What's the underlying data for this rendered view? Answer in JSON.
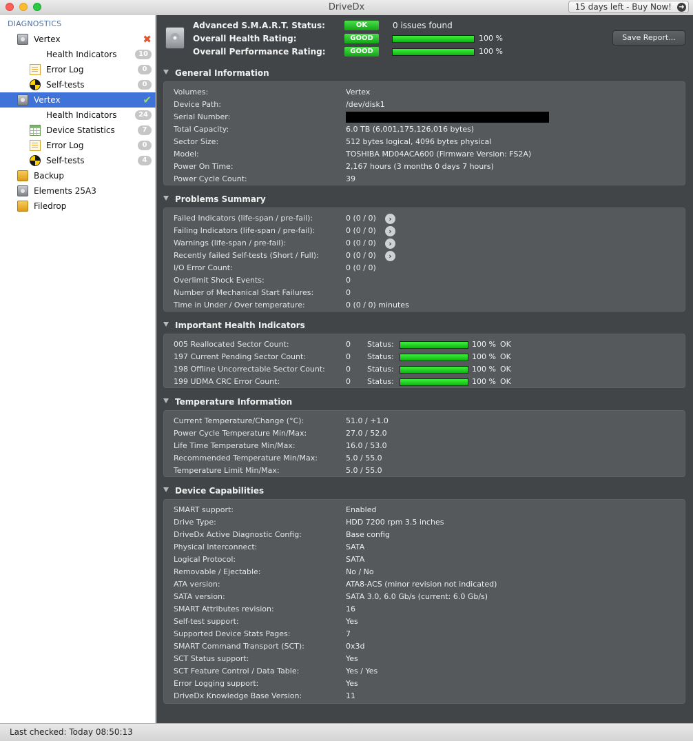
{
  "window": {
    "title": "DriveDx",
    "buy_label": "15 days left - Buy Now!"
  },
  "sidebar": {
    "header": "DIAGNOSTICS",
    "items": [
      {
        "label": "Vertex",
        "icon": "disk-icon",
        "mark": "✖"
      },
      {
        "label": "Health Indicators",
        "icon": "bars-icon",
        "badge": "10"
      },
      {
        "label": "Error Log",
        "icon": "log-icon",
        "badge": "0"
      },
      {
        "label": "Self-tests",
        "icon": "selftest-icon",
        "badge": "0"
      },
      {
        "label": "Vertex",
        "icon": "disk-icon",
        "mark": "✔",
        "selected": true
      },
      {
        "label": "Health Indicators",
        "icon": "bars-icon",
        "badge": "24"
      },
      {
        "label": "Device Statistics",
        "icon": "table-icon",
        "badge": "7"
      },
      {
        "label": "Error Log",
        "icon": "log-icon",
        "badge": "0"
      },
      {
        "label": "Self-tests",
        "icon": "selftest-icon",
        "badge": "4"
      },
      {
        "label": "Backup",
        "icon": "external-disk-icon"
      },
      {
        "label": "Elements 25A3",
        "icon": "disk-icon"
      },
      {
        "label": "Filedrop",
        "icon": "external-disk-icon"
      }
    ]
  },
  "summary": {
    "smart_label": "Advanced S.M.A.R.T. Status:",
    "smart_badge": "OK",
    "smart_text": "0 issues found",
    "health_label": "Overall Health Rating:",
    "health_badge": "GOOD",
    "health_value": 1.0,
    "health_pct": "100 %",
    "perf_label": "Overall Performance Rating:",
    "perf_badge": "GOOD",
    "perf_value": 1.0,
    "perf_pct": "100 %",
    "save_label": "Save Report..."
  },
  "general": {
    "title": "General Information",
    "rows": [
      {
        "label": "Volumes:",
        "value": "Vertex"
      },
      {
        "label": "Device Path:",
        "value": "/dev/disk1"
      },
      {
        "label": "Serial Number:",
        "value": ""
      },
      {
        "label": "Total Capacity:",
        "value": "6.0 TB (6,001,175,126,016 bytes)"
      },
      {
        "label": "Sector Size:",
        "value": "512 bytes logical, 4096 bytes physical"
      },
      {
        "label": "Model:",
        "value": "TOSHIBA MD04ACA600  (Firmware Version: FS2A)"
      },
      {
        "label": "Power On Time:",
        "value": "2,167 hours (3 months 0 days 7 hours)"
      },
      {
        "label": "Power Cycle Count:",
        "value": "39"
      }
    ]
  },
  "problems": {
    "title": "Problems Summary",
    "rows": [
      {
        "label": "Failed Indicators (life-span / pre-fail):",
        "value": "0 (0 / 0)",
        "arrow": true
      },
      {
        "label": "Failing Indicators (life-span / pre-fail):",
        "value": "0 (0 / 0)",
        "arrow": true
      },
      {
        "label": "Warnings (life-span / pre-fail):",
        "value": "0 (0 / 0)",
        "arrow": true
      },
      {
        "label": "Recently failed Self-tests (Short / Full):",
        "value": "0 (0 / 0)",
        "arrow": true
      },
      {
        "label": "I/O Error Count:",
        "value": "0 (0 / 0)"
      },
      {
        "label": "Overlimit Shock Events:",
        "value": "0"
      },
      {
        "label": "Number of Mechanical Start Failures:",
        "value": "0"
      },
      {
        "label": "Time in Under / Over temperature:",
        "value": "0 (0 / 0)  minutes"
      }
    ]
  },
  "health": {
    "title": "Important Health Indicators",
    "status_label": "Status:",
    "rows": [
      {
        "label": "005  Reallocated Sector Count:",
        "value": "0",
        "level": 1.0,
        "pct": "100 %",
        "status": "OK"
      },
      {
        "label": "197  Current Pending Sector Count:",
        "value": "0",
        "level": 1.0,
        "pct": "100 %",
        "status": "OK"
      },
      {
        "label": "198  Offline Uncorrectable Sector Count:",
        "value": "0",
        "level": 1.0,
        "pct": "100 %",
        "status": "OK"
      },
      {
        "label": "199  UDMA CRC Error Count:",
        "value": "0",
        "level": 1.0,
        "pct": "100 %",
        "status": "OK"
      }
    ]
  },
  "temperature": {
    "title": "Temperature Information",
    "rows": [
      {
        "label": "Current Temperature/Change (°C):",
        "value": "51.0 / +1.0"
      },
      {
        "label": "Power Cycle Temperature Min/Max:",
        "value": "27.0 / 52.0"
      },
      {
        "label": "Life Time Temperature Min/Max:",
        "value": "16.0 / 53.0"
      },
      {
        "label": "Recommended Temperature Min/Max:",
        "value": "5.0  / 55.0"
      },
      {
        "label": "Temperature Limit Min/Max:",
        "value": "5.0  / 55.0"
      }
    ]
  },
  "capabilities": {
    "title": "Device Capabilities",
    "rows": [
      {
        "label": "SMART support:",
        "value": "Enabled"
      },
      {
        "label": "Drive Type:",
        "value": "HDD 7200 rpm 3.5 inches"
      },
      {
        "label": "DriveDx Active Diagnostic Config:",
        "value": "Base config"
      },
      {
        "label": "Physical Interconnect:",
        "value": "SATA"
      },
      {
        "label": "Logical Protocol:",
        "value": "SATA"
      },
      {
        "label": "Removable / Ejectable:",
        "value": "No / No"
      },
      {
        "label": "ATA version:",
        "value": "ATA8-ACS (minor revision not indicated)"
      },
      {
        "label": "SATA version:",
        "value": "SATA 3.0, 6.0 Gb/s (current: 6.0 Gb/s)"
      },
      {
        "label": "SMART Attributes revision:",
        "value": "16"
      },
      {
        "label": "Self-test support:",
        "value": "Yes"
      },
      {
        "label": "Supported Device Stats Pages:",
        "value": "7"
      },
      {
        "label": "SMART Command Transport (SCT):",
        "value": "0x3d"
      },
      {
        "label": "SCT Status support:",
        "value": "Yes"
      },
      {
        "label": "SCT Feature Control / Data Table:",
        "value": "Yes / Yes"
      },
      {
        "label": "Error Logging support:",
        "value": "Yes"
      },
      {
        "label": "DriveDx Knowledge Base Version:",
        "value": "11"
      }
    ]
  },
  "status_bar": {
    "text": "Last checked: Today 08:50:13"
  },
  "colors": {
    "accent_selected": "#3f73d9",
    "good_green": "#13a417",
    "panel_bg": "#56595c",
    "main_bg": "#424547"
  }
}
